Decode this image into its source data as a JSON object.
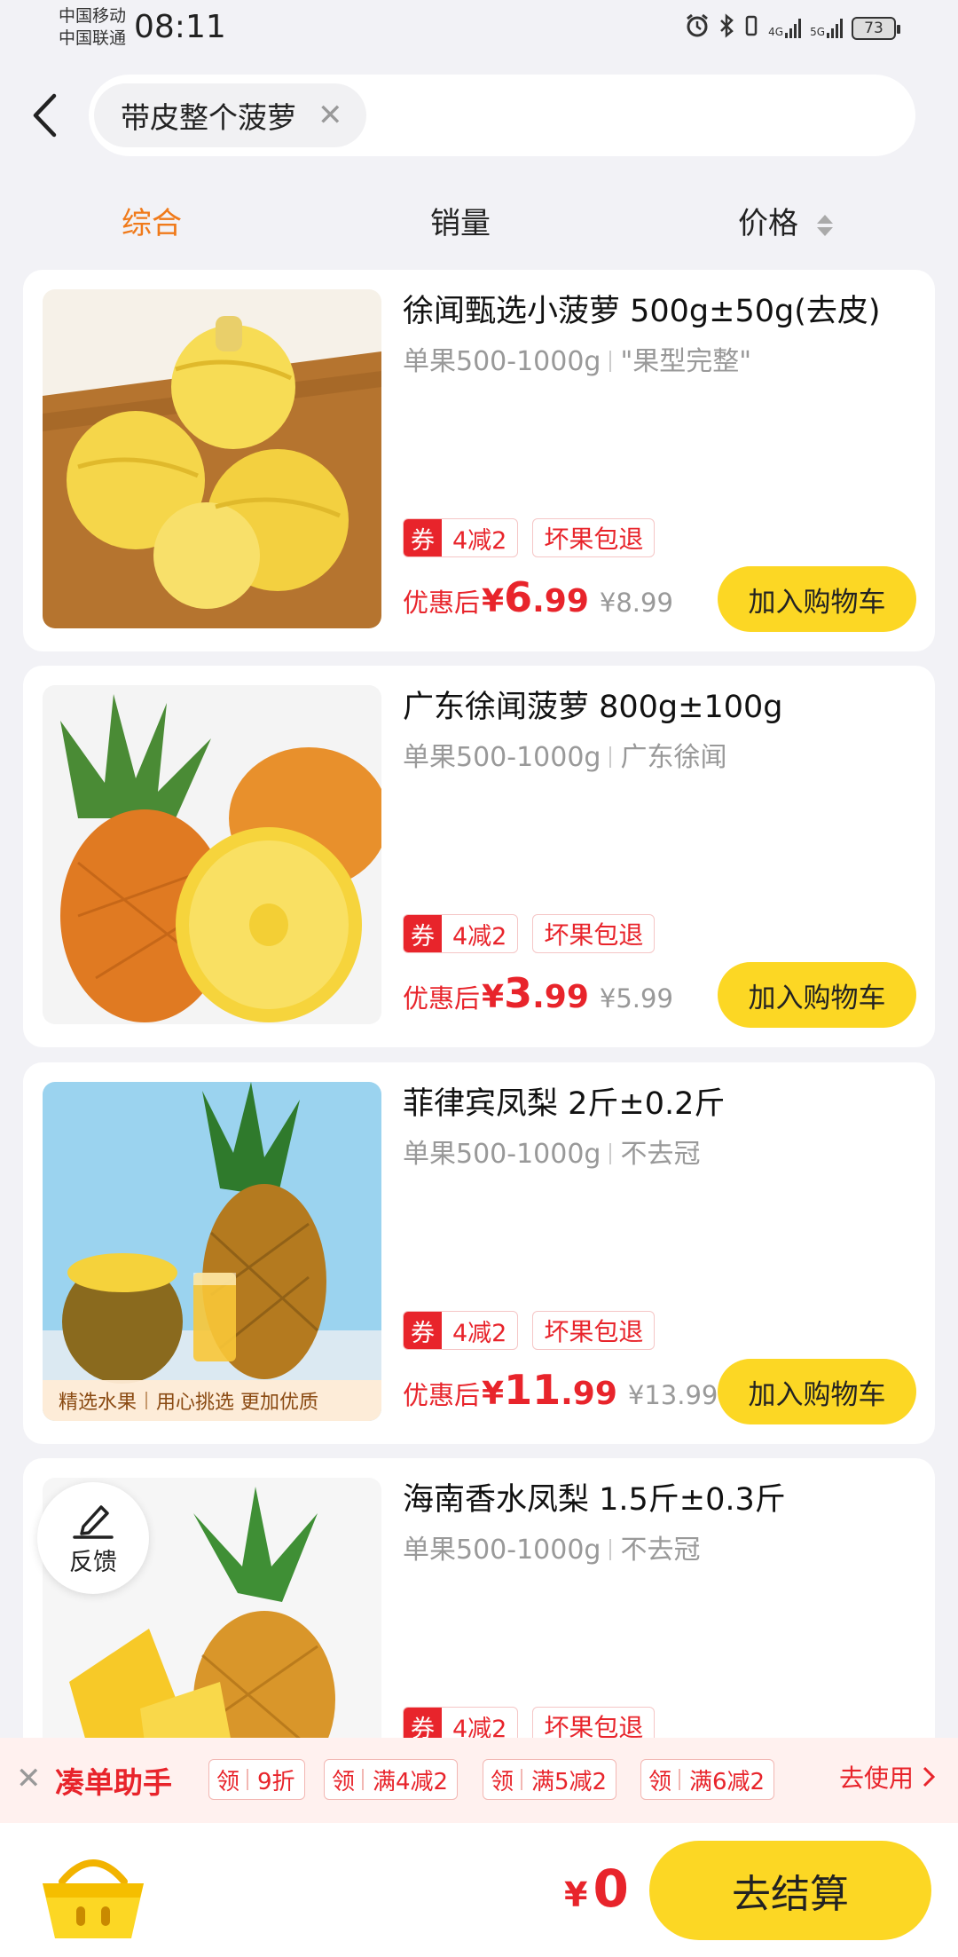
{
  "status_bar": {
    "carrier_1": "中国移动",
    "carrier_2": "中国联通",
    "time": "08:11",
    "network_1": "4G",
    "network_2": "5G",
    "battery": "73"
  },
  "search": {
    "query": "带皮整个菠萝"
  },
  "sort_tabs": [
    {
      "label": "综合",
      "active": true
    },
    {
      "label": "销量",
      "active": false
    },
    {
      "label": "价格",
      "active": false
    }
  ],
  "products": [
    {
      "title": "徐闻甄选小菠萝 500g±50g(去皮)",
      "spec_1": "单果500-1000g",
      "spec_2": "\"果型完整\"",
      "coupon_mark": "券",
      "coupon_text": "4减2",
      "service_tag": "坏果包退",
      "price_label": "优惠后",
      "currency": "¥",
      "price_int": "6",
      "price_dec": ".99",
      "original_price": "¥8.99",
      "cart_label": "加入购物车"
    },
    {
      "title": "广东徐闻菠萝 800g±100g",
      "spec_1": "单果500-1000g",
      "spec_2": "广东徐闻",
      "coupon_mark": "券",
      "coupon_text": "4减2",
      "service_tag": "坏果包退",
      "price_label": "优惠后",
      "currency": "¥",
      "price_int": "3",
      "price_dec": ".99",
      "original_price": "¥5.99",
      "cart_label": "加入购物车"
    },
    {
      "title": "菲律宾凤梨 2斤±0.2斤",
      "spec_1": "单果500-1000g",
      "spec_2": "不去冠",
      "coupon_mark": "券",
      "coupon_text": "4减2",
      "service_tag": "坏果包退",
      "price_label": "优惠后",
      "currency": "¥",
      "price_int": "11",
      "price_dec": ".99",
      "original_price": "¥13.99",
      "cart_label": "加入购物车",
      "image_banner": [
        "精选水果",
        "用心挑选 更加优质"
      ]
    },
    {
      "title": "海南香水凤梨 1.5斤±0.3斤",
      "spec_1": "单果500-1000g",
      "spec_2": "不去冠",
      "coupon_mark": "券",
      "coupon_text": "4减2",
      "service_tag": "坏果包退"
    }
  ],
  "feedback": {
    "label": "反馈"
  },
  "helper": {
    "title": "凑单助手",
    "claim_label": "领",
    "offers": [
      "9折",
      "满4减2",
      "满5减2",
      "满6减2"
    ],
    "use_label": "去使用"
  },
  "bottom": {
    "currency": "¥",
    "total": "0",
    "checkout_label": "去结算"
  },
  "colors": {
    "accent_orange": "#f07a1a",
    "price_red": "#e8242b",
    "button_yellow": "#fcd724"
  }
}
